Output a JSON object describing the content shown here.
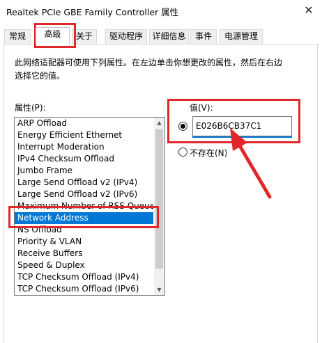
{
  "window": {
    "title": "Realtek PCIe GBE Family Controller 属性",
    "close_glyph": "✕"
  },
  "tabs": [
    {
      "label": "常规",
      "active": false
    },
    {
      "label": "高级",
      "active": true
    },
    {
      "label": "关于",
      "active": false
    },
    {
      "label": "驱动程序",
      "active": false
    },
    {
      "label": "详细信息",
      "active": false
    },
    {
      "label": "事件",
      "active": false
    },
    {
      "label": "电源管理",
      "active": false
    }
  ],
  "advanced": {
    "description": "此网络适配器可使用下列属性。在左边单击你想更改的属性，然后在右边选择它的值。",
    "property_label": "属性(P):",
    "value_label": "值(V):",
    "value": "E026B6CB37C1",
    "not_present_label": "不存在(N)",
    "selected_option": "value",
    "properties": [
      "ARP Offload",
      "Energy Efficient Ethernet",
      "Interrupt Moderation",
      "IPv4 Checksum Offload",
      "Jumbo Frame",
      "Large Send Offload v2 (IPv4)",
      "Large Send Offload v2 (IPv6)",
      "Maximum Number of RSS Queue",
      "Network Address",
      "NS Offload",
      "Priority & VLAN",
      "Receive Buffers",
      "Speed & Duplex",
      "TCP Checksum Offload (IPv4)",
      "TCP Checksum Offload (IPv6)"
    ],
    "selected_property": "Network Address",
    "scroll_up_glyph": "▲",
    "scroll_down_glyph": "▼"
  },
  "colors": {
    "highlight": "#e0282b",
    "selection": "#0078d7"
  }
}
